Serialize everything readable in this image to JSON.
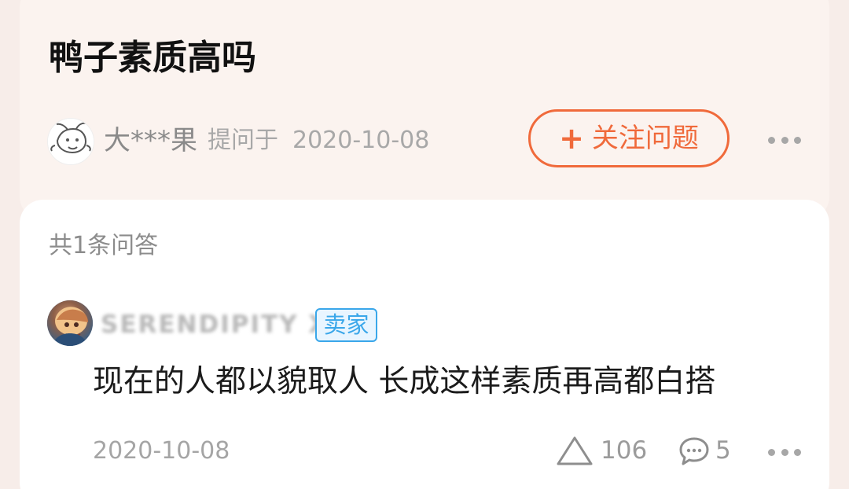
{
  "question": {
    "title": "鸭子素质高吗",
    "asker_name": "大***果",
    "asked_text": "提问于",
    "asked_date": "2020-10-08",
    "follow_button_label": "关注问题",
    "plus_icon": "+",
    "more_icon_name": "more-horizontal-icon"
  },
  "answers": {
    "count_text": "共1条问答",
    "item": {
      "username": "SERENDIPITY X1",
      "badge": "卖家",
      "content": "现在的人都以貌取人 长成这样素质再高都白搭",
      "date": "2020-10-08",
      "likes": "106",
      "comments": "5",
      "like_icon_name": "triangle-icon",
      "comment_icon_name": "comment-icon",
      "more_icon_name": "more-horizontal-icon"
    }
  },
  "colors": {
    "accent": "#f06a3b",
    "badge": "#3aa7ea",
    "background": "#f7ede9"
  }
}
